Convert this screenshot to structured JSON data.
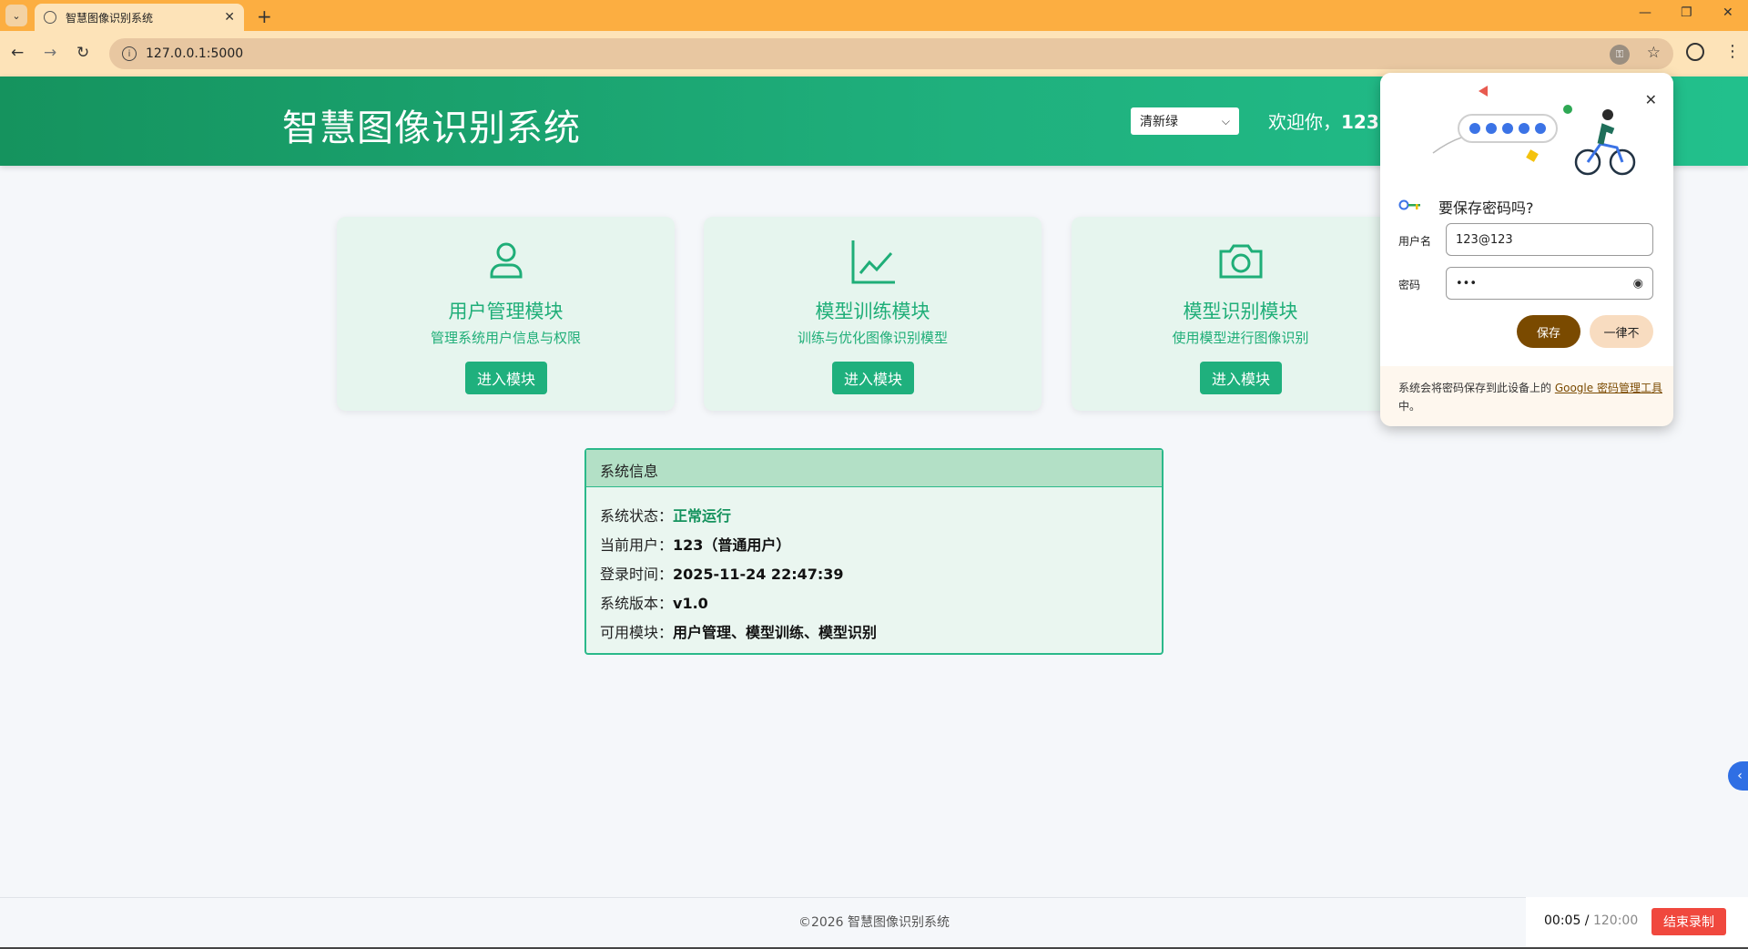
{
  "browser": {
    "tab_title": "智慧图像识别系统",
    "url": "127.0.0.1:5000",
    "close_tab_symbol": "✕",
    "new_tab_symbol": "+"
  },
  "header": {
    "brand": "智慧图像识别系统",
    "theme_value": "清新绿",
    "welcome_prefix": "欢迎你，",
    "welcome_user": "123"
  },
  "modules": [
    {
      "title": "用户管理模块",
      "desc": "管理系统用户信息与权限",
      "button": "进入模块",
      "icon": "user-icon"
    },
    {
      "title": "模型训练模块",
      "desc": "训练与优化图像识别模型",
      "button": "进入模块",
      "icon": "chart-line-icon"
    },
    {
      "title": "模型识别模块",
      "desc": "使用模型进行图像识别",
      "button": "进入模块",
      "icon": "camera-icon"
    }
  ],
  "sysinfo": {
    "title": "系统信息",
    "rows": [
      {
        "label": "系统状态：",
        "value": "正常运行"
      },
      {
        "label": "当前用户：",
        "value": "123（普通用户）"
      },
      {
        "label": "登录时间：",
        "value": "2025-11-24 22:47:39"
      },
      {
        "label": "系统版本：",
        "value": "v1.0"
      },
      {
        "label": "可用模块：",
        "value": "用户管理、模型训练、模型识别"
      }
    ]
  },
  "password_popup": {
    "title": "要保存密码吗?",
    "username_label": "用户名",
    "username_value": "123@123",
    "password_label": "密码",
    "password_value": "•••",
    "save_button": "保存",
    "never_button": "一律不",
    "footer_prefix": "系统会将密码保存到此设备上的 ",
    "footer_link": "Google 密码管理工具",
    "footer_suffix": "中。"
  },
  "footer": {
    "copyright": "©2026 智慧图像识别系统"
  },
  "recorder": {
    "elapsed": "00:05",
    "separator": " / ",
    "total": "120:00",
    "stop_button": "结束录制"
  },
  "colors": {
    "header_start": "#15935e",
    "header_end": "#22c08c",
    "accent": "#1fb07d",
    "tab_bar": "#fcae41",
    "record_red": "#f0483e",
    "save_brown": "#7a4a00"
  }
}
